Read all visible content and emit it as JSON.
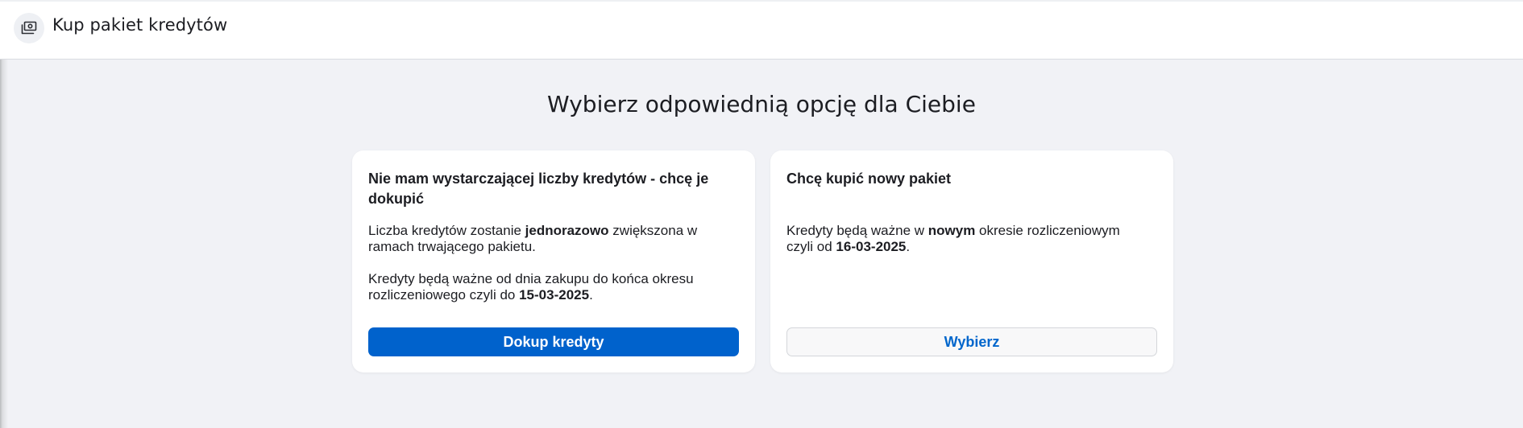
{
  "header": {
    "title": "Kup pakiet kredytów",
    "icon": "money-icon"
  },
  "main": {
    "heading": "Wybierz odpowiednią opcję dla Ciebie"
  },
  "cards": [
    {
      "title": "Nie mam wystarczającej liczby kredytów - chcę je dokupić",
      "p1_prefix": "Liczba kredytów zostanie ",
      "p1_bold": "jednorazowo",
      "p1_suffix": " zwiększona w ramach trwającego pakietu.",
      "p2_prefix": "Kredyty będą ważne od dnia zakupu do końca okresu rozliczeniowego czyli do ",
      "p2_bold": "15-03-2025",
      "p2_suffix": ".",
      "button_label": "Dokup kredyty"
    },
    {
      "title": "Chcę kupić nowy pakiet",
      "p1_prefix": "Kredyty będą ważne w ",
      "p1_bold": "nowym",
      "p1_middle": " okresie rozliczeniowym czyli od ",
      "p1_bold2": "16-03-2025",
      "p1_suffix": ".",
      "button_label": "Wybierz"
    }
  ],
  "colors": {
    "primary": "#0062cc",
    "background": "#f1f2f6",
    "text": "#1c1d22"
  }
}
